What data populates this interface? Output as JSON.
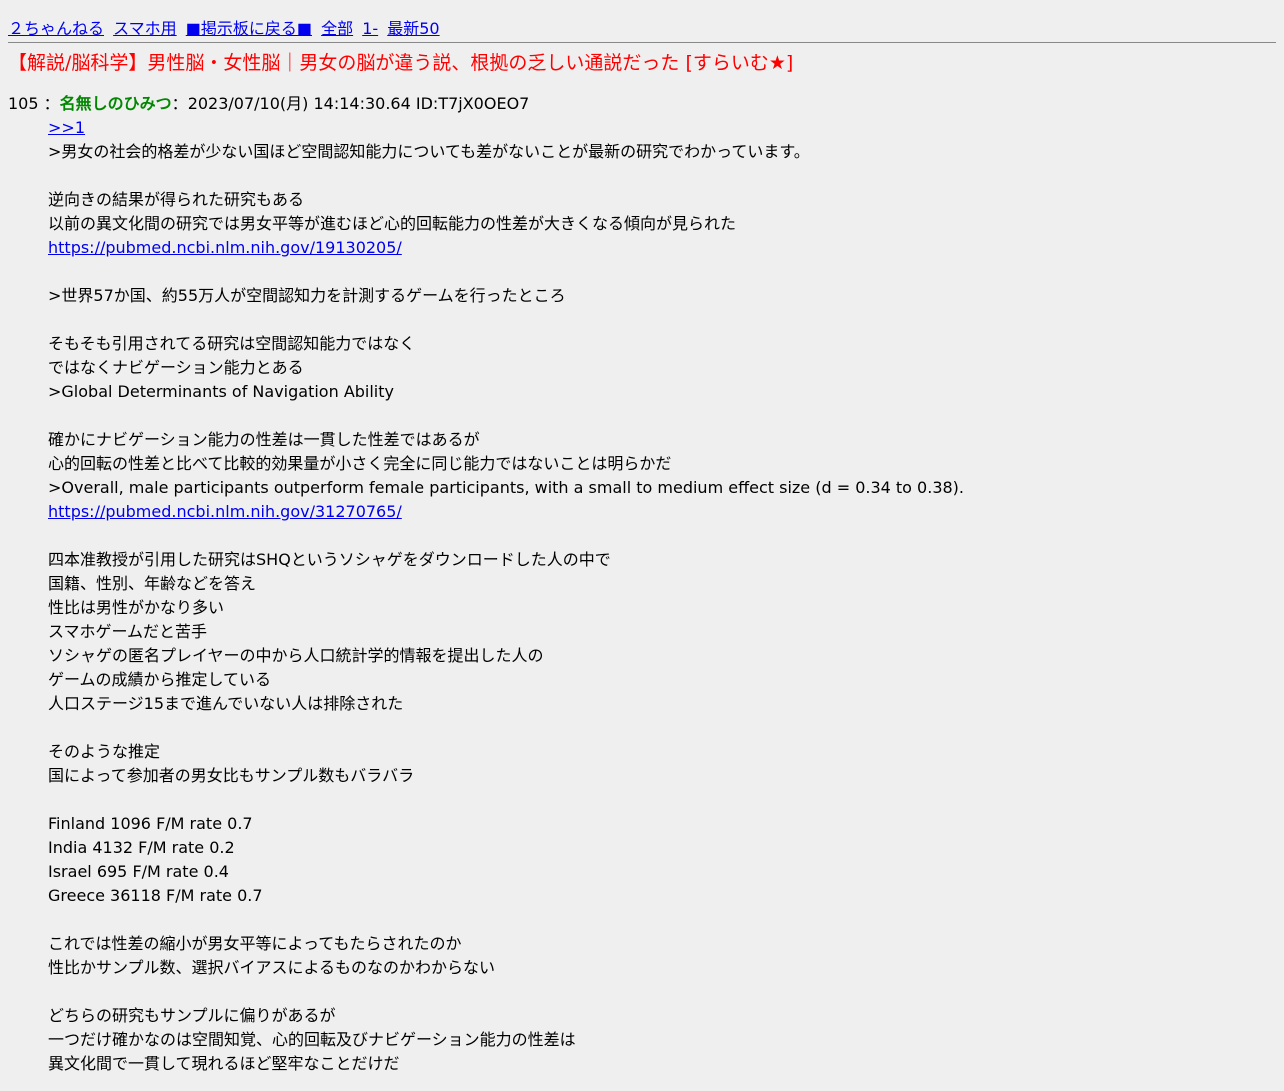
{
  "nav": {
    "home": "２ちゃんねる",
    "mobile": "スマホ用",
    "back_to_board": "■掲示板に戻る■",
    "all": "全部",
    "from_1": "1-",
    "latest50": "最新50"
  },
  "thread": {
    "title": "【解説/脳科学】男性脳・女性脳｜男女の脳が違う説、根拠の乏しい通説だった [すらいむ★]"
  },
  "post": {
    "number": "105",
    "separator1": "：",
    "name": "名無しのひみつ",
    "separator2": "：",
    "datetime": "2023/07/10(月) 14:14:30.64",
    "id": "ID:T7jX0OEO7",
    "anchor": ">>1",
    "lines": [
      ">男女の社会的格差が少ない国ほど空間認知能力についても差がないことが最新の研究でわかっています。",
      "",
      "逆向きの結果が得られた研究もある",
      "以前の異文化間の研究では男女平等が進むほど心的回転能力の性差が大きくなる傾向が見られた",
      "https://pubmed.ncbi.nlm.nih.gov/19130205/",
      "",
      ">世界57か国、約55万人が空間認知力を計測するゲームを行ったところ",
      "",
      "そもそも引用されてる研究は空間認知能力ではなく",
      "ではなくナビゲーション能力とある",
      ">Global Determinants of Navigation Ability",
      "",
      "確かにナビゲーション能力の性差は一貫した性差ではあるが",
      "心的回転の性差と比べて比較的効果量が小さく完全に同じ能力ではないことは明らかだ",
      ">Overall, male participants outperform female participants, with a small to medium effect size (d = 0.34 to 0.38).",
      "https://pubmed.ncbi.nlm.nih.gov/31270765/",
      "",
      "四本准教授が引用した研究はSHQというソシャゲをダウンロードした人の中で",
      "国籍、性別、年齢などを答え",
      "性比は男性がかなり多い",
      "スマホゲームだと苦手",
      "ソシャゲの匿名プレイヤーの中から人口統計学的情報を提出した人の",
      "ゲームの成績から推定している",
      "人口ステージ15まで進んでいない人は排除された",
      "",
      "そのような推定",
      "国によって参加者の男女比もサンプル数もバラバラ",
      "",
      "Finland 1096 F/M rate 0.7",
      "India  4132  F/M rate 0.2",
      "Israel 695 F/M rate 0.4",
      "Greece 36118  F/M rate 0.7",
      "",
      "これでは性差の縮小が男女平等によってもたらされたのか",
      "性比かサンプル数、選択バイアスによるものなのかわからない",
      "",
      "どちらの研究もサンプルに偏りがあるが",
      "一つだけ確かなのは空間知覚、心的回転及びナビゲーション能力の性差は",
      "異文化間で一貫して現れるほど堅牢なことだけだ"
    ]
  },
  "colors": {
    "background": "#efefef",
    "link": "#0000ee",
    "title": "#ff0000",
    "name": "#008800",
    "text": "#000000"
  }
}
